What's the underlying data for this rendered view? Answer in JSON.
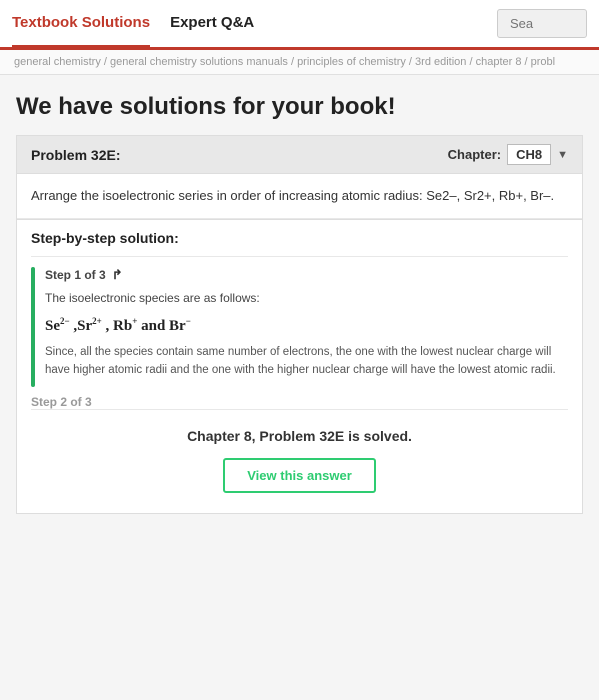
{
  "navbar": {
    "items": [
      {
        "label": "Textbook Solutions",
        "active": true
      },
      {
        "label": "Expert Q&A",
        "active": false
      }
    ],
    "search_placeholder": "Sea"
  },
  "breadcrumb": {
    "text": "general chemistry / general chemistry solutions manuals / principles of chemistry / 3rd edition / chapter 8 / probl"
  },
  "main": {
    "page_title": "We have solutions for your book!",
    "problem": {
      "label": "Problem 32E:",
      "chapter_label": "Chapter:",
      "chapter_value": "CH8",
      "problem_text": "Arrange the isoelectronic series in order of increasing atomic radius: Se2–, Sr2+, Rb+, Br–."
    },
    "solution": {
      "header": "Step-by-step solution:",
      "steps": [
        {
          "title": "Step 1 of 3",
          "intro": "The isoelectronic species are as follows:",
          "formula": "Se²⁻, Sr²⁺, Rb⁺ and Br⁻",
          "explanation": "Since, all the species contain same number of electrons, the one with the lowest nuclear charge will have higher atomic radii and the one with the higher nuclear charge will have the lowest atomic radii."
        },
        {
          "title": "Step 2 of 3"
        }
      ]
    },
    "solved": {
      "text": "Chapter 8, Problem 32E is solved.",
      "button_label": "View this answer"
    }
  }
}
